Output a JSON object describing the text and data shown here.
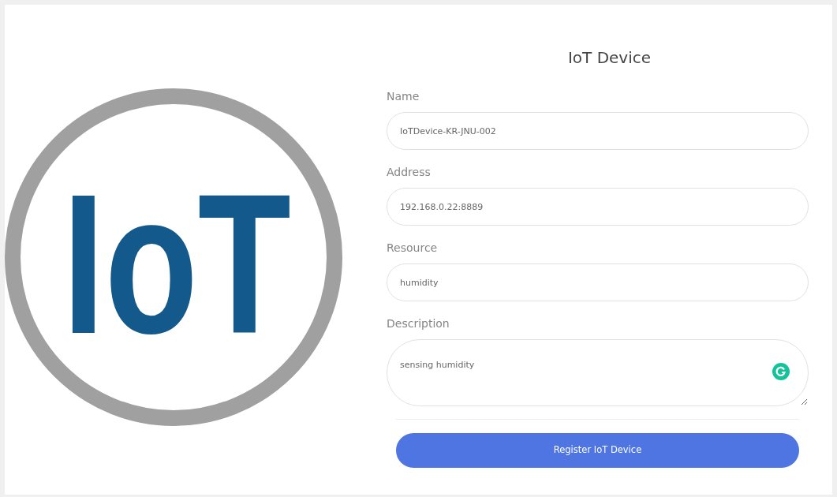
{
  "logo": {
    "text": "IoT"
  },
  "form": {
    "title": "IoT Device",
    "fields": [
      {
        "kind": "input",
        "label": "Name",
        "value": "IoTDevice-KR-JNU-002"
      },
      {
        "kind": "input",
        "label": "Address",
        "value": "192.168.0.22:8889"
      },
      {
        "kind": "input",
        "label": "Resource",
        "value": "humidity"
      },
      {
        "kind": "textarea",
        "label": "Description",
        "value": "sensing humidity"
      }
    ],
    "submit": "Register IoT Device"
  }
}
